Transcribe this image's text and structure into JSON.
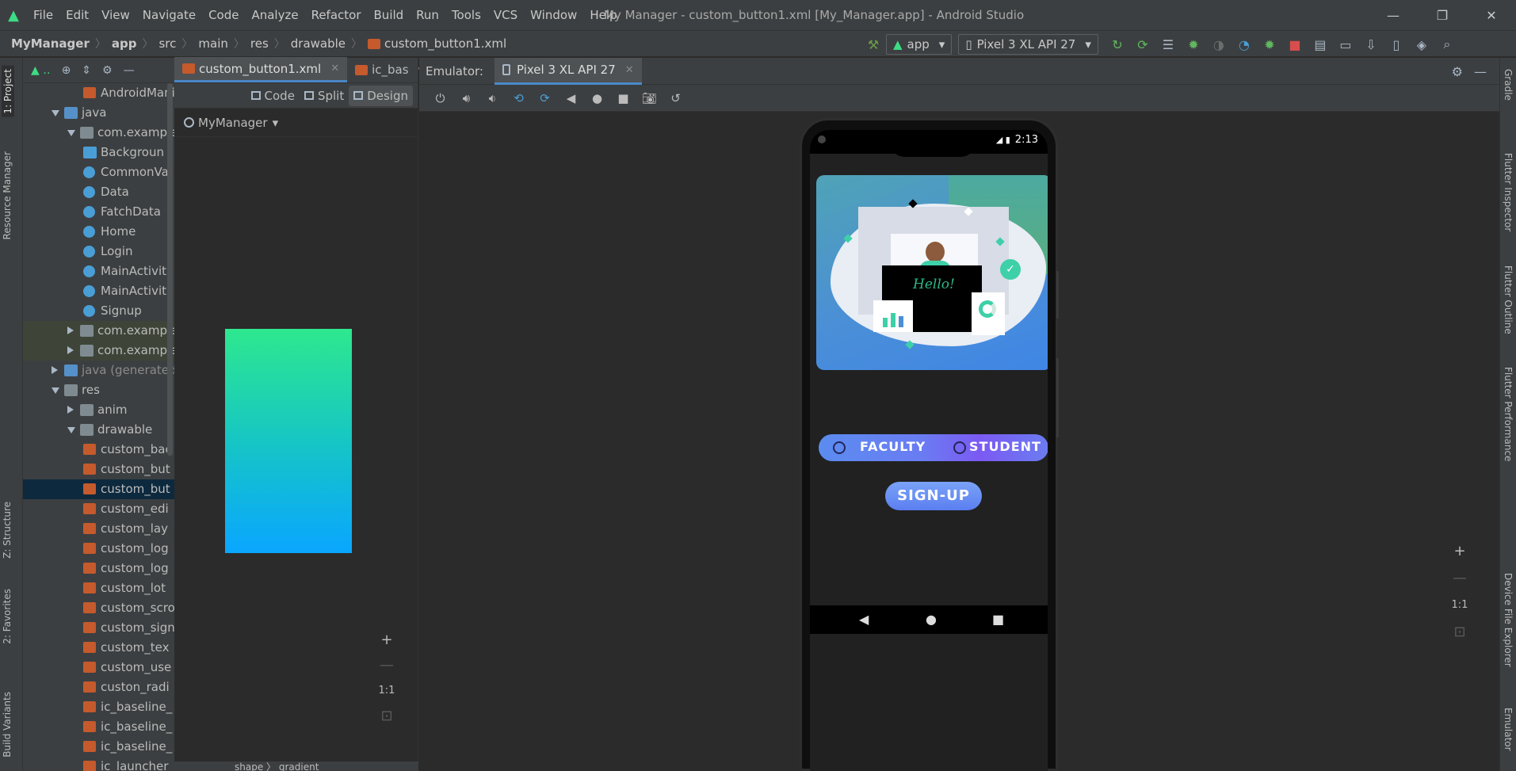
{
  "window": {
    "title": "My Manager - custom_button1.xml [My_Manager.app] - Android Studio",
    "menu": [
      "File",
      "Edit",
      "View",
      "Navigate",
      "Code",
      "Analyze",
      "Refactor",
      "Build",
      "Run",
      "Tools",
      "VCS",
      "Window",
      "Help"
    ]
  },
  "breadcrumb": [
    "MyManager",
    "app",
    "src",
    "main",
    "res",
    "drawable",
    "custom_button1.xml"
  ],
  "run_config": {
    "module": "app",
    "device": "Pixel 3 XL API 27"
  },
  "left_stripe": {
    "project": "1: Project",
    "resource_manager": "Resource Manager",
    "structure": "Z: Structure",
    "favorites": "2: Favorites",
    "build_variants": "Build Variants"
  },
  "tree": [
    {
      "label": "AndroidManife",
      "indent": 3,
      "icon": "manifest",
      "dim": false
    },
    {
      "label": "java",
      "indent": 1,
      "arrow": "down",
      "icon": "folder-blue"
    },
    {
      "label": "com.example.m",
      "indent": 2,
      "arrow": "down",
      "icon": "folder"
    },
    {
      "label": "Backgroun",
      "indent": 3,
      "icon": "layout"
    },
    {
      "label": "CommonVa",
      "indent": 3,
      "icon": "class"
    },
    {
      "label": "Data",
      "indent": 3,
      "icon": "class"
    },
    {
      "label": "FatchData",
      "indent": 3,
      "icon": "class"
    },
    {
      "label": "Home",
      "indent": 3,
      "icon": "class"
    },
    {
      "label": "Login",
      "indent": 3,
      "icon": "class"
    },
    {
      "label": "MainActivit",
      "indent": 3,
      "icon": "class"
    },
    {
      "label": "MainActivit",
      "indent": 3,
      "icon": "class"
    },
    {
      "label": "Signup",
      "indent": 3,
      "icon": "class"
    },
    {
      "label": "com.example.m",
      "indent": 2,
      "arrow": "right",
      "icon": "folder",
      "hl": true
    },
    {
      "label": "com.example.m",
      "indent": 2,
      "arrow": "right",
      "icon": "folder",
      "hl": true
    },
    {
      "label": "java (generated)",
      "indent": 1,
      "arrow": "right",
      "icon": "folder-blue",
      "dim": true
    },
    {
      "label": "res",
      "indent": 1,
      "arrow": "down",
      "icon": "folder"
    },
    {
      "label": "anim",
      "indent": 2,
      "arrow": "right",
      "icon": "folder"
    },
    {
      "label": "drawable",
      "indent": 2,
      "arrow": "down",
      "icon": "folder"
    },
    {
      "label": "custom_bac",
      "indent": 3,
      "icon": "xml"
    },
    {
      "label": "custom_but",
      "indent": 3,
      "icon": "xml"
    },
    {
      "label": "custom_but",
      "indent": 3,
      "icon": "xml",
      "selected": true
    },
    {
      "label": "custom_edi",
      "indent": 3,
      "icon": "xml"
    },
    {
      "label": "custom_lay",
      "indent": 3,
      "icon": "xml"
    },
    {
      "label": "custom_log",
      "indent": 3,
      "icon": "xml"
    },
    {
      "label": "custom_log",
      "indent": 3,
      "icon": "xml"
    },
    {
      "label": "custom_lot",
      "indent": 3,
      "icon": "xml"
    },
    {
      "label": "custom_scro",
      "indent": 3,
      "icon": "xml"
    },
    {
      "label": "custom_sign",
      "indent": 3,
      "icon": "xml"
    },
    {
      "label": "custom_tex",
      "indent": 3,
      "icon": "xml"
    },
    {
      "label": "custom_use",
      "indent": 3,
      "icon": "xml"
    },
    {
      "label": "custon_radi",
      "indent": 3,
      "icon": "xml"
    },
    {
      "label": "ic_baseline_",
      "indent": 3,
      "icon": "xml"
    },
    {
      "label": "ic_baseline_",
      "indent": 3,
      "icon": "xml"
    },
    {
      "label": "ic_baseline_",
      "indent": 3,
      "icon": "xml"
    },
    {
      "label": "ic_launcher_",
      "indent": 3,
      "icon": "xml"
    }
  ],
  "editor": {
    "tabs": [
      "custom_button1.xml",
      "ic_bas"
    ],
    "modes": {
      "code": "Code",
      "split": "Split",
      "design": "Design"
    },
    "theme": "MyManager",
    "gradient_colors": [
      "#2ee88e",
      "#0aa6ff"
    ],
    "zoom_fit": "1:1",
    "status": [
      "shape",
      "gradient"
    ]
  },
  "emulator": {
    "label": "Emulator:",
    "tab": "Pixel 3 XL API 27",
    "time": "2:13",
    "app": {
      "hello": "Hello!",
      "faculty": "FACULTY",
      "student": "STUDENT",
      "signup": "SIGN-UP"
    },
    "zoom_fit": "1:1"
  },
  "right_stripe": [
    "Gradle",
    "Flutter Inspector",
    "Flutter Outline",
    "Flutter Performance",
    "Device File Explorer",
    "Emulator"
  ]
}
